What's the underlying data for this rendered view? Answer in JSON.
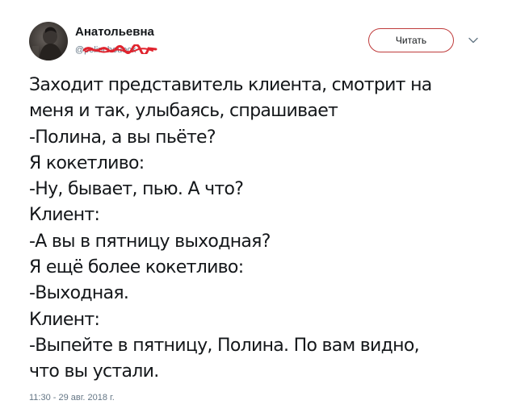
{
  "author": {
    "name": "Анатольевна",
    "handle": "@polinchouock",
    "avatar_icon": "user-avatar"
  },
  "follow_button_label": "Читать",
  "menu_icon": "chevron-down-icon",
  "tweet_lines": [
    "Заходит представитель клиента, смотрит на",
    "меня и так, улыбаясь, спрашивает",
    "-Полина, а вы пьёте?",
    "Я кокетливо:",
    "-Ну, бывает, пью. А что?",
    "Клиент:",
    "-А вы в пятницу выходная?",
    "Я ещё более кокетливо:",
    "-Выходная.",
    "Клиент:",
    "-Выпейте в пятницу, Полина. По вам видно,",
    "что вы устали."
  ],
  "timestamp": "11:30 - 29 авг. 2018 г.",
  "colors": {
    "redaction": "#e0242e",
    "button_border": "#bf3b3b",
    "muted_text": "#657786"
  }
}
